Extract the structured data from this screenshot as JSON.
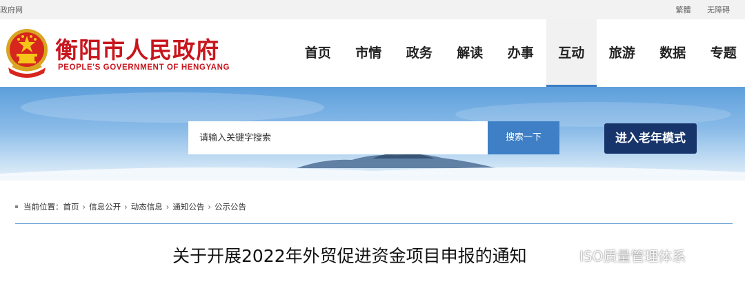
{
  "topbar": {
    "site_name": "政府网",
    "links": [
      "繁體",
      "无障碍"
    ]
  },
  "header": {
    "title_cn": "衡阳市人民政府",
    "title_en": "PEOPLE'S GOVERNMENT OF HENGYANG",
    "emblem_icon": "national-emblem-icon",
    "brand_color": "#c8161d"
  },
  "nav": {
    "items": [
      "首页",
      "市情",
      "政务",
      "解读",
      "办事",
      "互动",
      "旅游",
      "数据",
      "专题"
    ],
    "active": "互动",
    "accent_color": "#3a7cc4"
  },
  "search": {
    "placeholder": "请输入关键字搜索",
    "button_label": "搜索一下"
  },
  "elder_mode": {
    "label": "进入老年模式"
  },
  "breadcrumb": {
    "prefix": "当前位置：",
    "items": [
      "首页",
      "信息公开",
      "动态信息",
      "通知公告",
      "公示公告"
    ]
  },
  "article": {
    "title": "关于开展2022年外贸促进资金项目申报的通知"
  },
  "watermark": {
    "text": "ISO质量管理体系",
    "icon": "wechat-icon"
  }
}
